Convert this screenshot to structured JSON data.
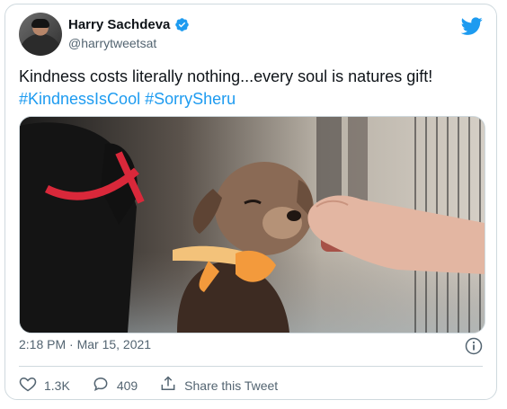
{
  "author": {
    "name": "Harry Sachdeva",
    "handle": "@harrytweetsat",
    "verified": true
  },
  "tweet": {
    "text": "Kindness costs literally nothing...every soul is natures gift!",
    "hashtags": [
      "#KindnessIsCool",
      "#SorrySheru"
    ]
  },
  "meta": {
    "timestamp": "2:18 PM · Mar 15, 2021"
  },
  "actions": {
    "likes": "1.3K",
    "replies": "409",
    "share_label": "Share this Tweet"
  },
  "colors": {
    "accent": "#1d9bf0",
    "text": "#0f1419",
    "muted": "#536471",
    "border": "#cfd9de"
  },
  "icons": {
    "verified": "verified-badge-icon",
    "brand": "twitter-bird-icon",
    "info": "info-icon",
    "like": "heart-icon",
    "reply": "reply-bubble-icon",
    "share": "share-icon"
  }
}
